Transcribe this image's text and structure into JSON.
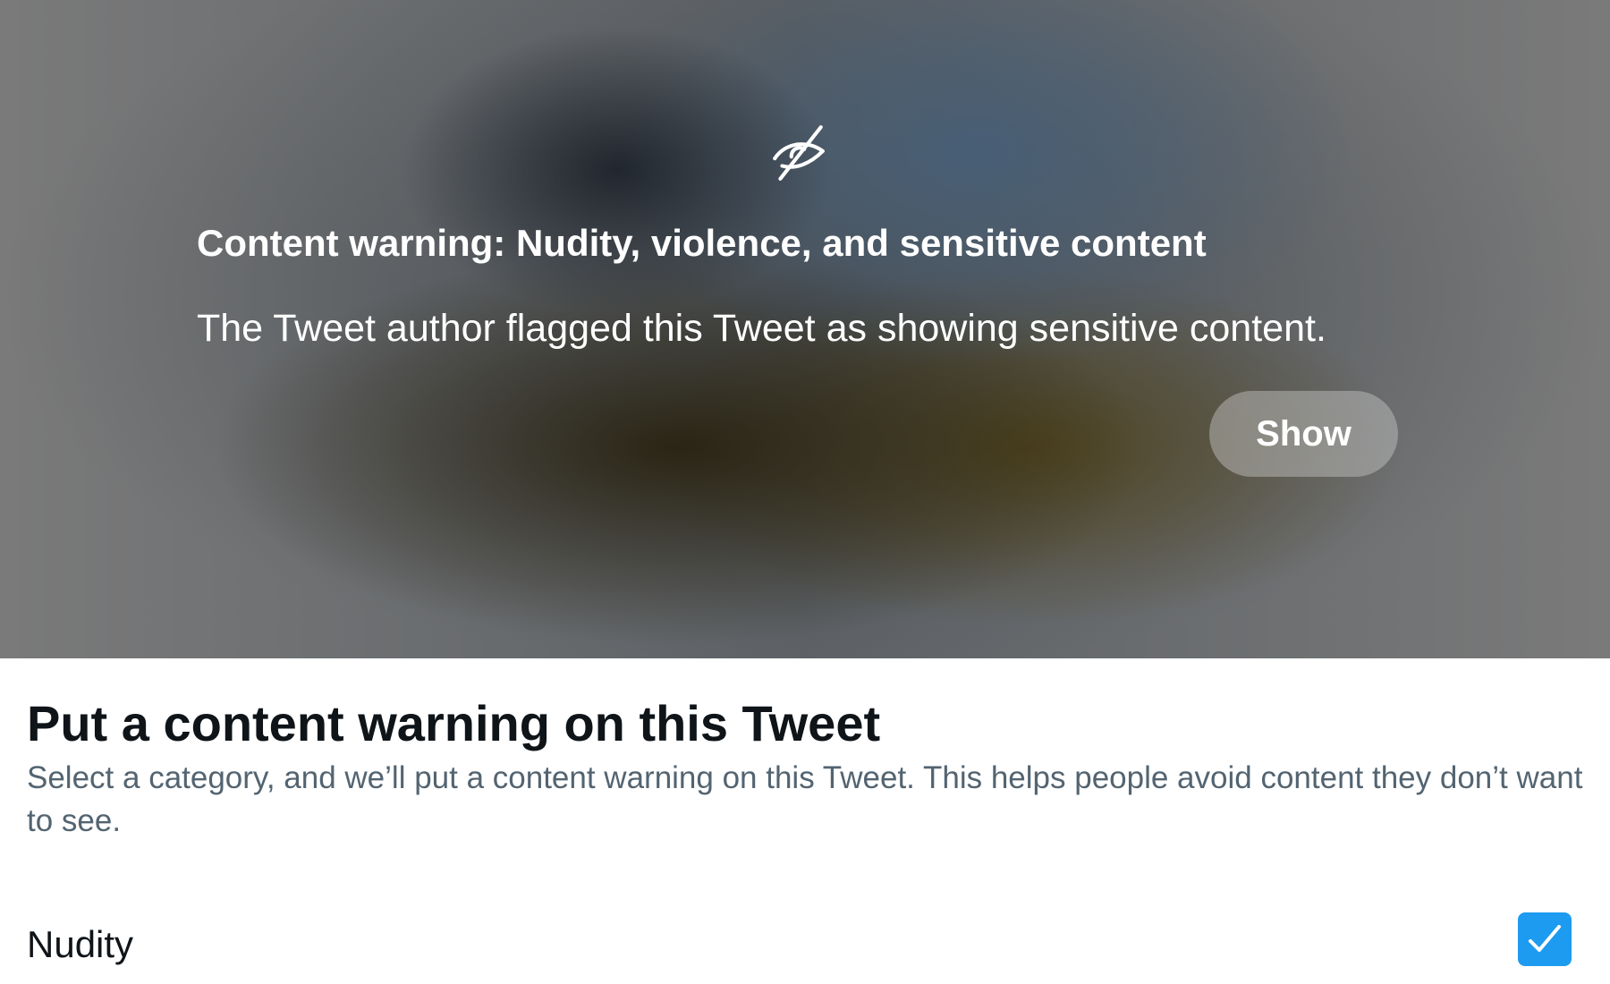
{
  "media": {
    "icon": "eye-slash-icon",
    "warning_title": "Content warning: Nudity, violence, and sensitive content",
    "warning_description": "The Tweet author flagged this Tweet as showing sensitive content.",
    "show_label": "Show"
  },
  "panel": {
    "title": "Put a content warning on this Tweet",
    "description": "Select a category, and we’ll put a content warning on this Tweet. This helps people avoid content they don’t want to see.",
    "options": [
      {
        "label": "Nudity",
        "checked": true
      }
    ]
  },
  "colors": {
    "accent": "#1d9bf0",
    "text_primary": "#0f1419",
    "text_secondary": "#536471"
  }
}
